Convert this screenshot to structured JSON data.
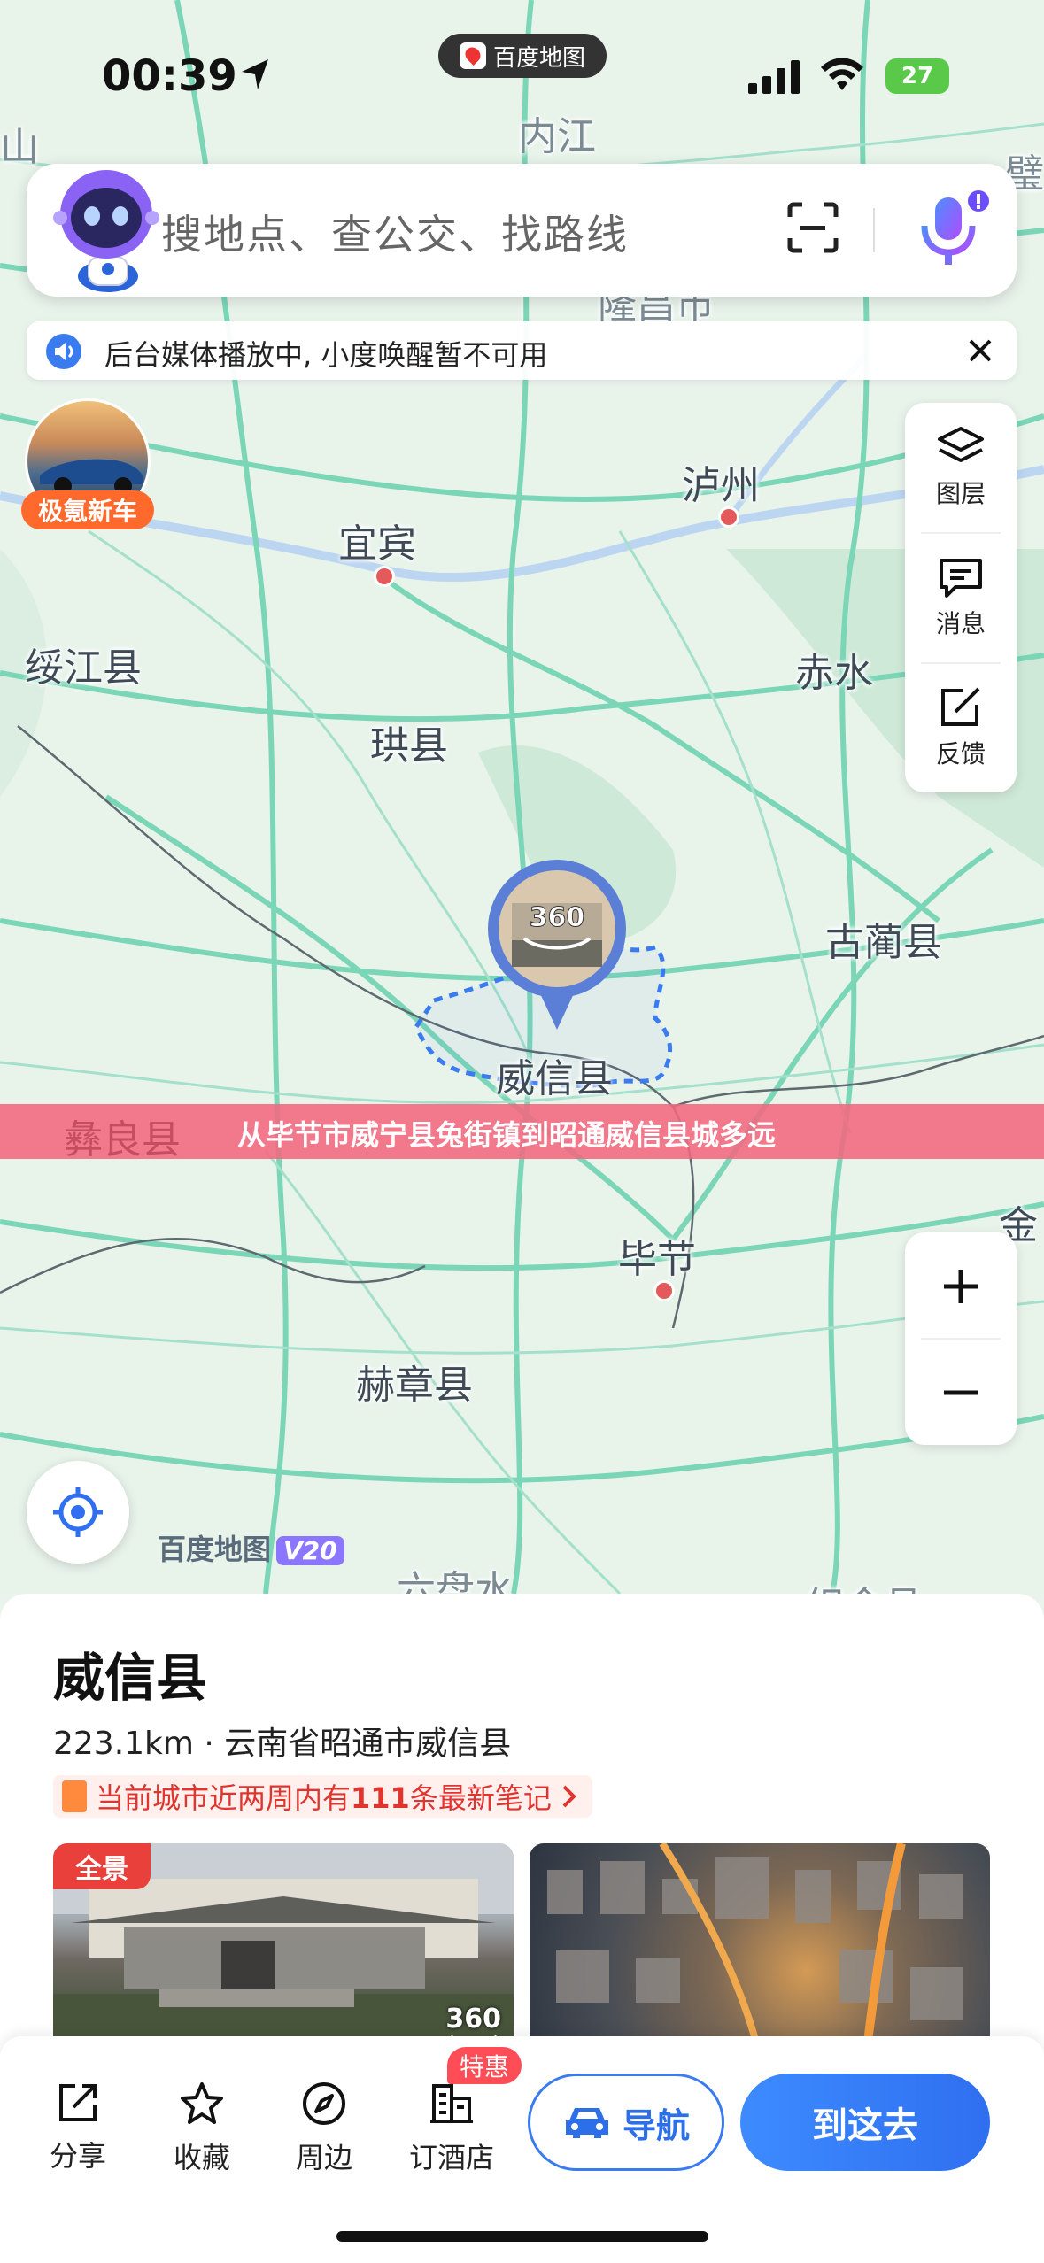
{
  "status_bar": {
    "time": "00:39",
    "app_label": "百度地图",
    "battery": "27"
  },
  "search": {
    "placeholder": "搜地点、查公交、找路线"
  },
  "notice": {
    "text": "后台媒体播放中, 小度唤醒暂不可用"
  },
  "ad": {
    "label": "极氪新车"
  },
  "tools": [
    {
      "label": "图层",
      "icon": "layers-icon"
    },
    {
      "label": "消息",
      "icon": "message-icon"
    },
    {
      "label": "反馈",
      "icon": "feedback-icon"
    }
  ],
  "map": {
    "labels": {
      "neijiang": "内江",
      "longchang": "隆昌市",
      "shan": "山",
      "bi": "璧",
      "luzhou": "泸州",
      "yibin": "宜宾",
      "suijiang": "绥江县",
      "chishui": "赤水",
      "gongxian": "珙县",
      "gulin": "古蔺县",
      "weixin": "威信县",
      "yiliang": "彝良县",
      "jin": "金",
      "bijie": "毕节",
      "hezhang": "赫章县",
      "liupanshui": "六盘水",
      "zhijin": "织金县"
    },
    "pin_text": "360",
    "brand": "百度地图",
    "brand_version": "V20"
  },
  "banner": {
    "text": "从毕节市威宁县兔街镇到昭通威信县城多远"
  },
  "place": {
    "name": "威信县",
    "meta": "223.1km · 云南省昭通市威信县",
    "notes_prefix": "当前城市近两周内有",
    "notes_count": "111",
    "notes_suffix": "条最新笔记",
    "pano_tag": "全景",
    "pano_badge": "360"
  },
  "bottom_bar": {
    "share": "分享",
    "favorite": "收藏",
    "nearby": "周边",
    "hotel": "订酒店",
    "deal": "特惠",
    "navigate": "导航",
    "go": "到这去"
  },
  "colors": {
    "accent": "#3a7bf0",
    "banner": "#f3687e",
    "notes": "#e0342f"
  }
}
